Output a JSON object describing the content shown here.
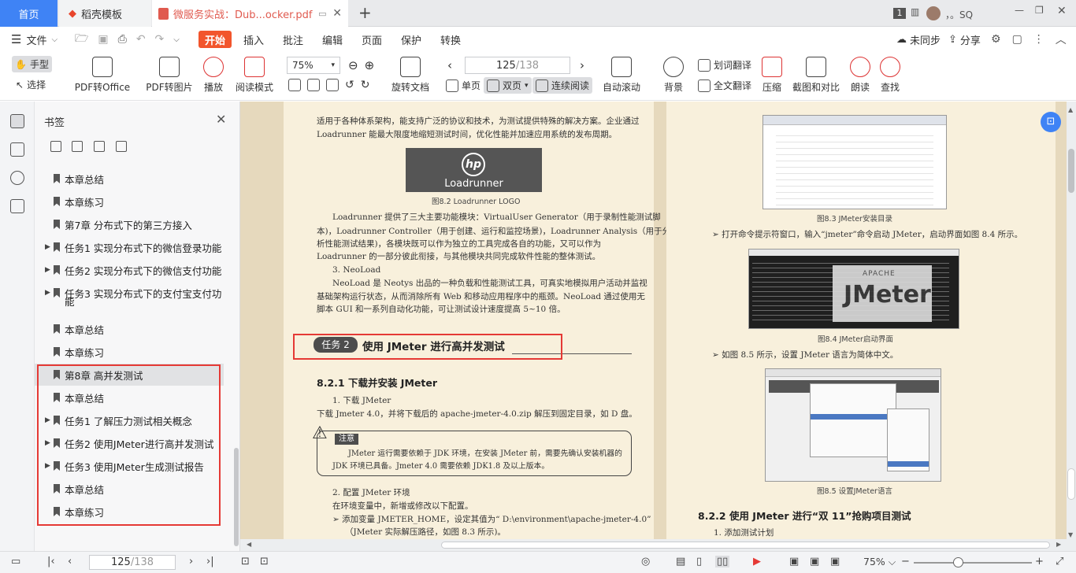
{
  "tabs": {
    "home": "首页",
    "template": "稻壳模板",
    "doc": "微服务实战：Dub...ocker.pdf",
    "badge": "1",
    "user": "，。SQ"
  },
  "menu": {
    "file": "文件",
    "items": [
      "开始",
      "插入",
      "批注",
      "编辑",
      "页面",
      "保护",
      "转换"
    ],
    "sync": "未同步",
    "share": "分享"
  },
  "toolbar": {
    "hand": "手型",
    "select": "选择",
    "pdf_office": "PDF转Office",
    "pdf_image": "PDF转图片",
    "play": "播放",
    "read_mode": "阅读模式",
    "zoom": "75%",
    "rotate": "旋转文档",
    "page_current": "125",
    "page_total": "/138",
    "single": "单页",
    "double": "双页",
    "continuous": "连续阅读",
    "auto_scroll": "自动滚动",
    "background": "背景",
    "word_translate": "划词翻译",
    "full_translate": "全文翻译",
    "compress": "压缩",
    "compare": "截图和对比",
    "read_aloud": "朗读",
    "find": "查找"
  },
  "bookmarks": {
    "title": "书签",
    "items": [
      {
        "text": "本章总结",
        "arrow": ""
      },
      {
        "text": "本章练习",
        "arrow": ""
      },
      {
        "text": "第7章  分布式下的第三方接入",
        "arrow": ""
      },
      {
        "text": "任务1  实现分布式下的微信登录功能",
        "arrow": "▶"
      },
      {
        "text": "任务2  实现分布式下的微信支付功能",
        "arrow": "▶"
      },
      {
        "text": "任务3  实现分布式下的支付宝支付功",
        "arrow": "▶"
      },
      {
        "text": "能",
        "arrow": ""
      },
      {
        "text": "本章总结",
        "arrow": ""
      },
      {
        "text": "本章练习",
        "arrow": ""
      },
      {
        "text": "第8章  高并发测试",
        "arrow": ""
      },
      {
        "text": "本章总结",
        "arrow": ""
      },
      {
        "text": "任务1  了解压力测试相关概念",
        "arrow": "▶"
      },
      {
        "text": "任务2  使用JMeter进行高并发测试",
        "arrow": "▶"
      },
      {
        "text": "任务3  使用JMeter生成测试报告",
        "arrow": "▶"
      },
      {
        "text": "本章总结",
        "arrow": ""
      },
      {
        "text": "本章练习",
        "arrow": ""
      }
    ]
  },
  "left_page": {
    "l1": "适用于各种体系架构，能支持广泛的协议和技术，为测试提供特殊的解决方案。企业通过",
    "l2": "Loadrunner 能最大限度地缩短测试时间，优化性能并加速应用系统的发布周期。",
    "logo_text": "Loadrunner",
    "logo_mark": "hp",
    "fig82": "图8.2    Loadrunner LOGO",
    "p2_1": "Loadrunner 提供了三大主要功能模块：VirtualUser Generator（用于录制性能测试脚",
    "p2_2": "本)，Loadrunner Controller（用于创建、运行和监控场景)，Loadrunner Analysis（用于分",
    "p2_3": "析性能测试结果)，各模块既可以作为独立的工具完成各自的功能，又可以作为",
    "p2_4": "Loadrunner 的一部分彼此衔接，与其他模块共同完成软件性能的整体测试。",
    "h3": "3.   NeoLoad",
    "p3_1": "NeoLoad 是 Neotys 出品的一种负载和性能测试工具，可真实地模拟用户活动并监视",
    "p3_2": "基础架构运行状态，从而消除所有 Web 和移动应用程序中的瓶颈。NeoLoad 通过使用无",
    "p3_3": "脚本 GUI 和一系列自动化功能，可让测试设计速度提高 5~10 倍。",
    "task_badge": "任务 2",
    "task_title": "使用 JMeter 进行高并发测试",
    "h821": "8.2.1    下载并安装 JMeter",
    "s1": "1.   下载 JMeter",
    "s1p": "下载 Jmeter 4.0，并将下载后的 apache-jmeter-4.0.zip 解压到固定目录，如 D 盘。",
    "note_label": "注意",
    "note1": "JMeter 运行需要依赖于 JDK 环境，在安装 JMeter 前，需要先确认安装机器的",
    "note2": "JDK 环境已具备。Jmeter 4.0 需要依赖 JDK1.8 及以上版本。",
    "s2": "2.   配置 JMeter 环境",
    "s2p": "在环境变量中，新增或修改以下配置。",
    "b1": "➢  添加变量  JMETER_HOME，设定其值为“ D:\\environment\\apache-jmeter-4.0”",
    "b1b": "（JMeter 实际解压路径，如图 8.3 所示)。"
  },
  "right_page": {
    "fig83": "图8.3    JMeter安装目录",
    "bullet1": "➢  打开命令提示符窗口，输入“jmeter”命令启动 JMeter，启动界面如图 8.4 所示。",
    "jmeter_apache": "APACHE",
    "jmeter_logo": "JMeter",
    "fig84": "图8.4    JMeter启动界面",
    "bullet2": "➢  如图 8.5 所示，设置 JMeter 语言为简体中文。",
    "fig85": "图8.5    设置JMeter语言",
    "h822": "8.2.2    使用 JMeter 进行“双 11”抢购项目测试",
    "s1": "1.   添加测试计划"
  },
  "status": {
    "page_current": "125",
    "page_total": "/138",
    "zoom": "75%"
  },
  "colors": {
    "accent": "#3f83f5",
    "active_menu": "#f2552c",
    "highlight_box": "#e53935",
    "page_bg": "#f8f0dc"
  }
}
